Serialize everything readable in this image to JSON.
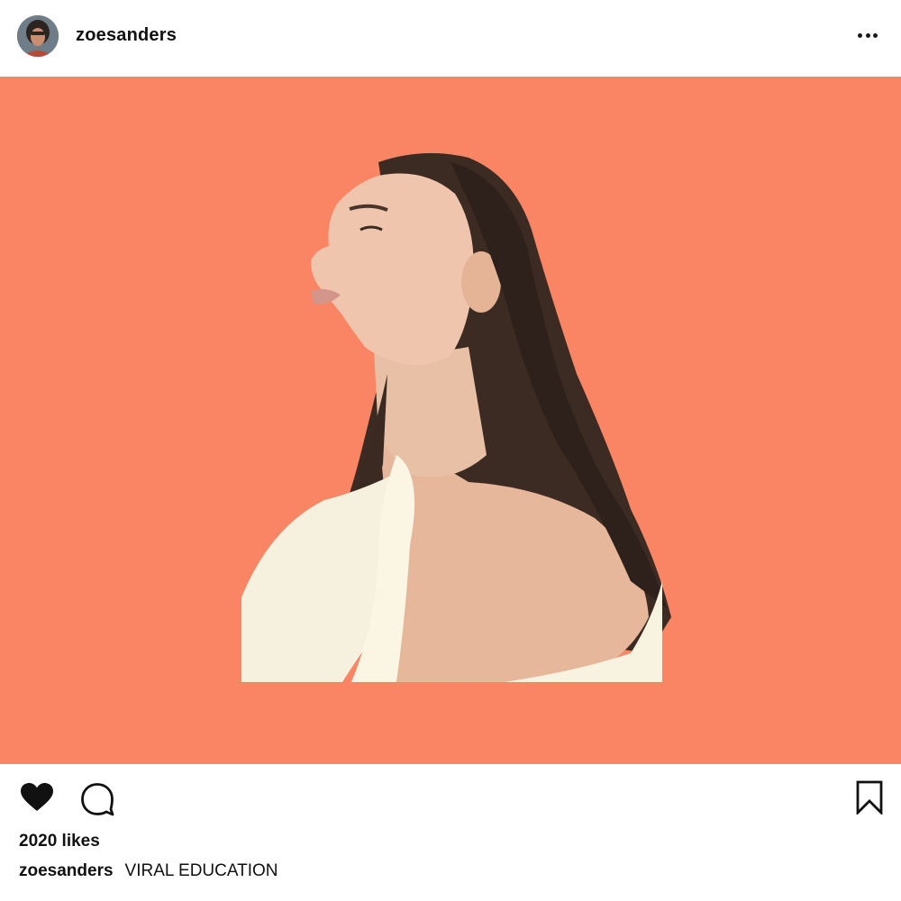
{
  "post": {
    "username": "zoesanders",
    "image": {
      "subject": "profile-portrait",
      "background_color": "#FA8565"
    },
    "likes_text": "2020 likes",
    "caption": {
      "username": "zoesanders",
      "text": "VIRAL EDUCATION"
    }
  },
  "icons": {
    "more": "more-horizontal-icon",
    "like": "heart-icon",
    "comment": "comment-bubble-icon",
    "save": "bookmark-icon"
  },
  "colors": {
    "text": "#111111",
    "icon": "#1a1a1a",
    "image_background": "#FA8565"
  }
}
